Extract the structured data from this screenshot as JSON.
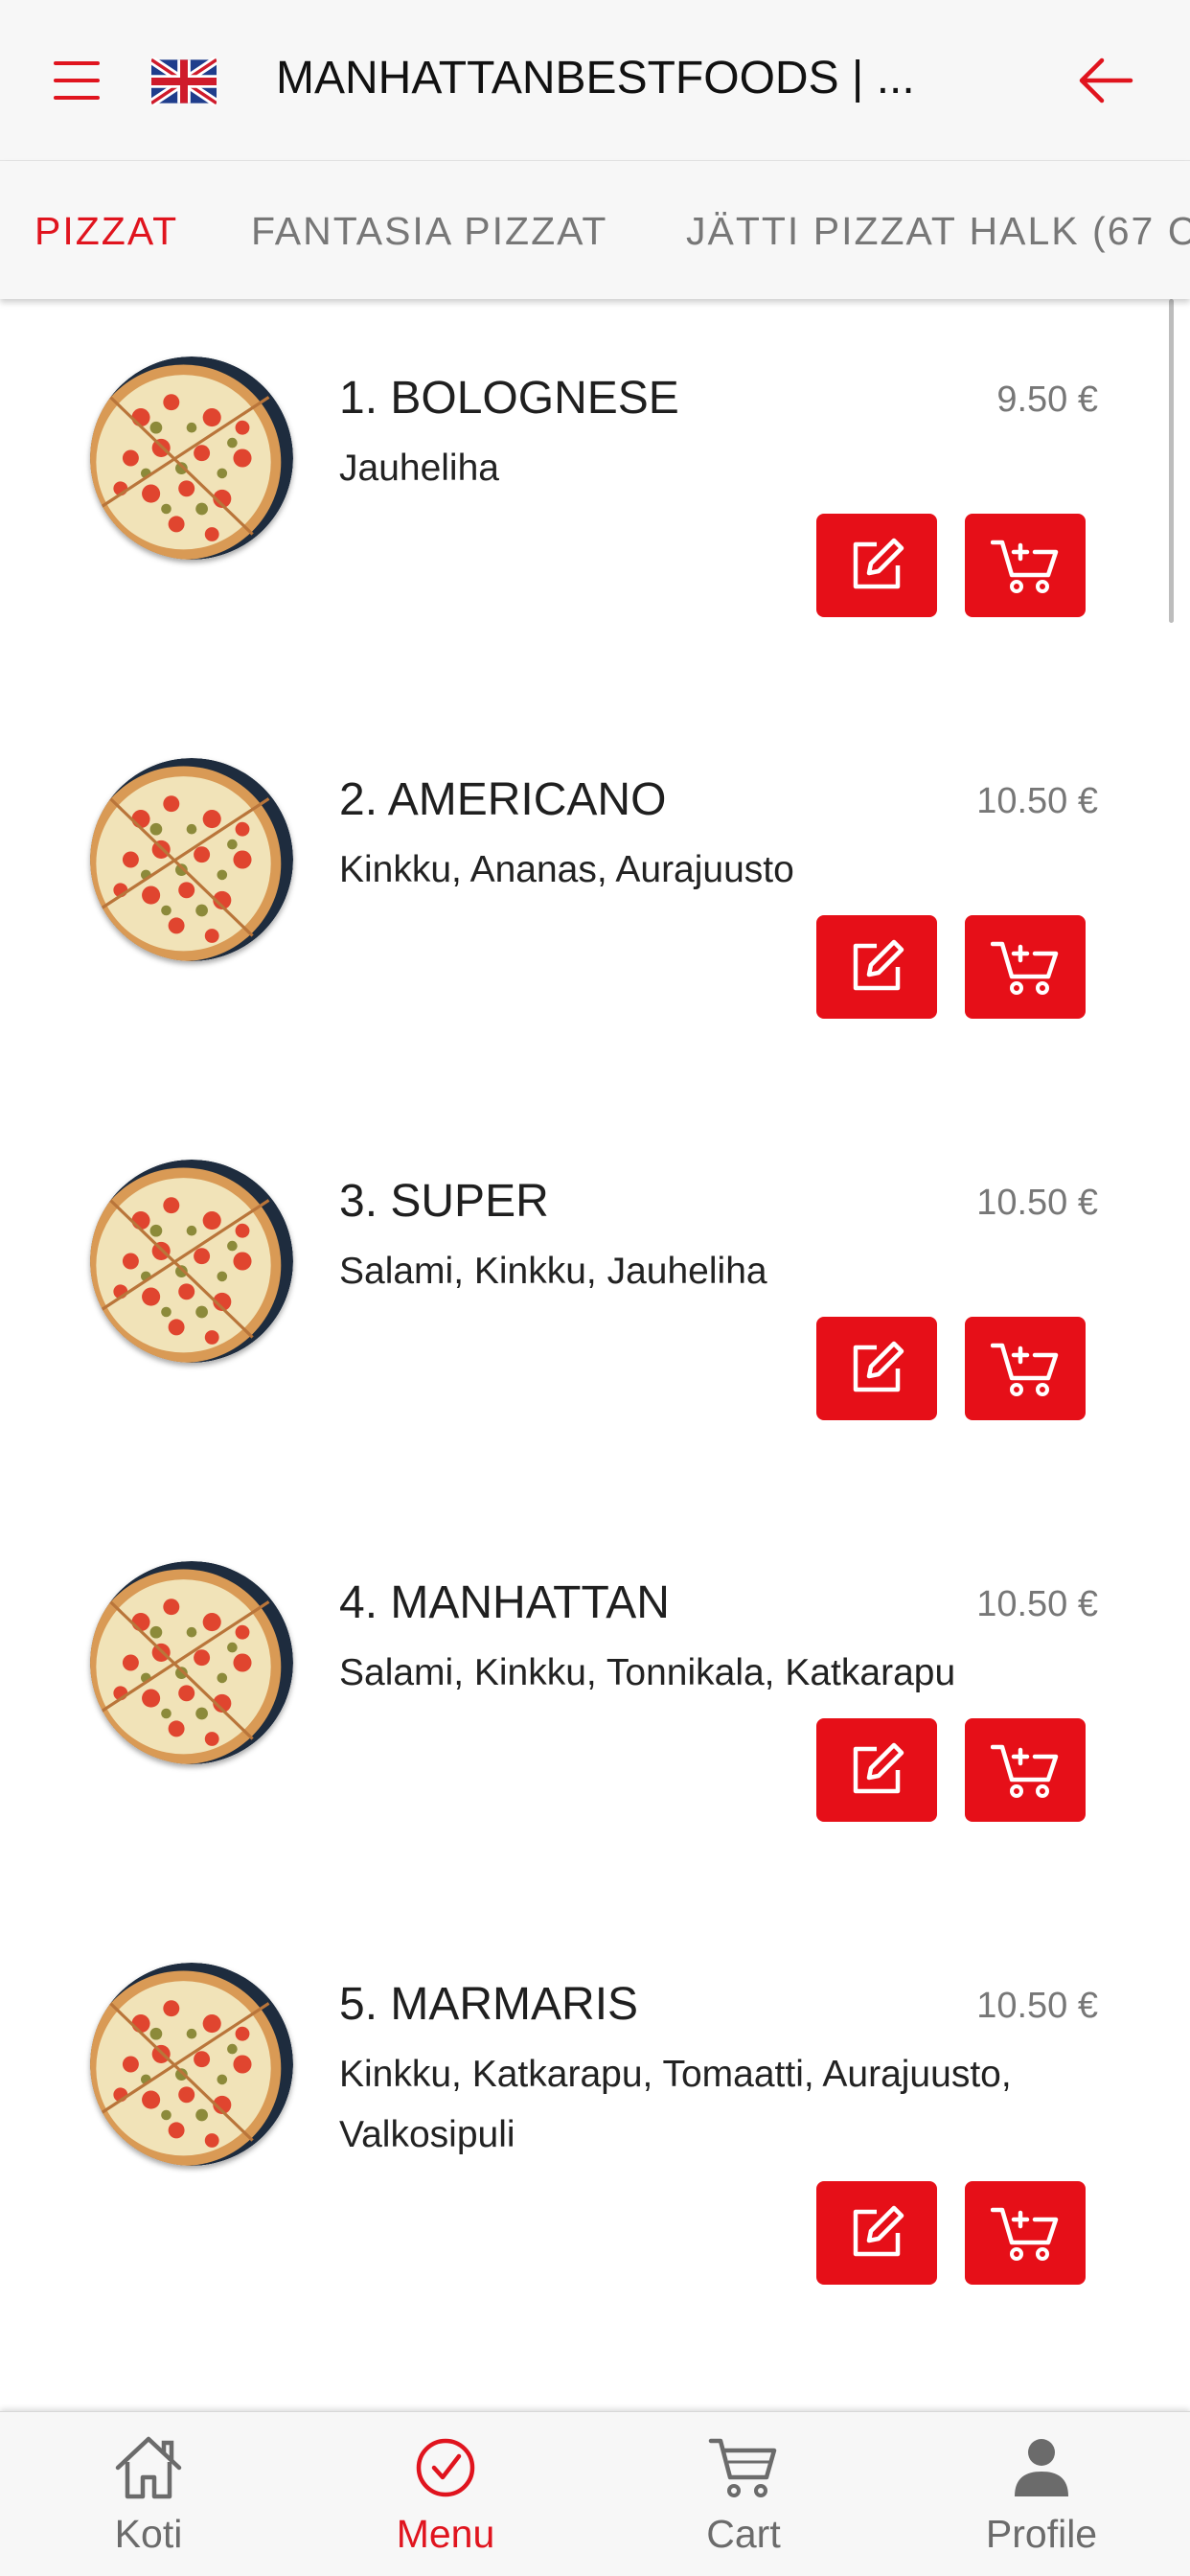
{
  "header": {
    "title": "MANHATTANBESTFOODS | ...",
    "menu_icon": "hamburger-icon",
    "flag_icon": "uk-flag-icon",
    "back_icon": "arrow-left-icon"
  },
  "tabs": [
    {
      "label": "PIZZAT",
      "active": true
    },
    {
      "label": "FANTASIA PIZZAT",
      "active": false
    },
    {
      "label": "JÄTTI PIZZAT HALK (67 C",
      "active": false
    }
  ],
  "items": [
    {
      "name": "1. BOLOGNESE",
      "price": "9.50 €",
      "description": "Jauheliha"
    },
    {
      "name": "2. AMERICANO",
      "price": "10.50 €",
      "description": "Kinkku, Ananas, Aurajuusto"
    },
    {
      "name": "3. SUPER",
      "price": "10.50 €",
      "description": "Salami, Kinkku, Jauheliha"
    },
    {
      "name": "4. MANHATTAN",
      "price": "10.50 €",
      "description": "Salami, Kinkku, Tonnikala, Katkarapu"
    },
    {
      "name": "5. MARMARIS",
      "price": "10.50 €",
      "description": "Kinkku, Katkarapu, Tomaatti, Aurajuusto, Valkosipuli"
    }
  ],
  "item_buttons": {
    "edit_icon": "edit-icon",
    "add_to_cart_icon": "cart-plus-icon"
  },
  "bottom_nav": [
    {
      "label": "Koti",
      "icon": "home-icon",
      "active": false
    },
    {
      "label": "Menu",
      "icon": "check-circle-icon",
      "active": true
    },
    {
      "label": "Cart",
      "icon": "cart-icon",
      "active": false
    },
    {
      "label": "Profile",
      "icon": "person-icon",
      "active": false
    }
  ],
  "colors": {
    "accent": "#e0141e",
    "button": "#e60f18",
    "muted": "#777777",
    "bar_background": "#f7f7f7"
  }
}
